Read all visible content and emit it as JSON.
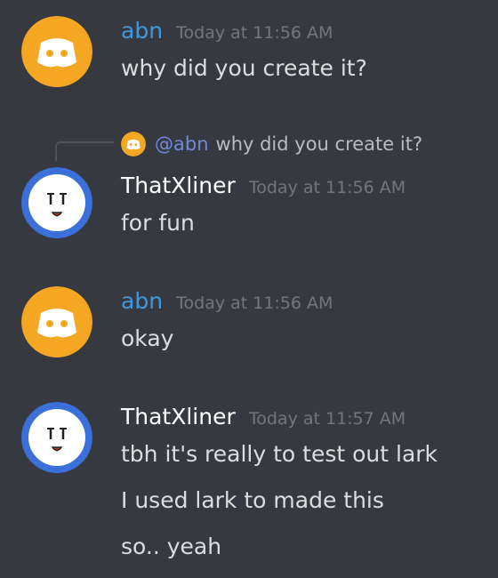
{
  "messages": [
    {
      "author": "abn",
      "timestamp": "Today at 11:56 AM",
      "avatar_icon": "discord-logo-icon",
      "lines": [
        "why did you create it?"
      ]
    },
    {
      "author": "ThatXliner",
      "timestamp": "Today at 11:56 AM",
      "avatar_icon": "cartoon-face-icon",
      "reply": {
        "mention": "@abn",
        "text": "why did you create it?"
      },
      "lines": [
        "for fun"
      ]
    },
    {
      "author": "abn",
      "timestamp": "Today at 11:56 AM",
      "avatar_icon": "discord-logo-icon",
      "lines": [
        "okay"
      ]
    },
    {
      "author": "ThatXliner",
      "timestamp": "Today at 11:57 AM",
      "avatar_icon": "cartoon-face-icon",
      "lines": [
        "tbh it's really to test out lark",
        "I used lark to made this",
        "so.. yeah"
      ]
    }
  ],
  "colors": {
    "background": "#36393f",
    "abn_name": "#3d9ae0",
    "thatxliner_name": "#ffffff",
    "timestamp": "#72767d",
    "mention": "#7289da",
    "abn_avatar_bg": "#f5a623",
    "thatxliner_avatar_ring": "#3b6fd9"
  }
}
